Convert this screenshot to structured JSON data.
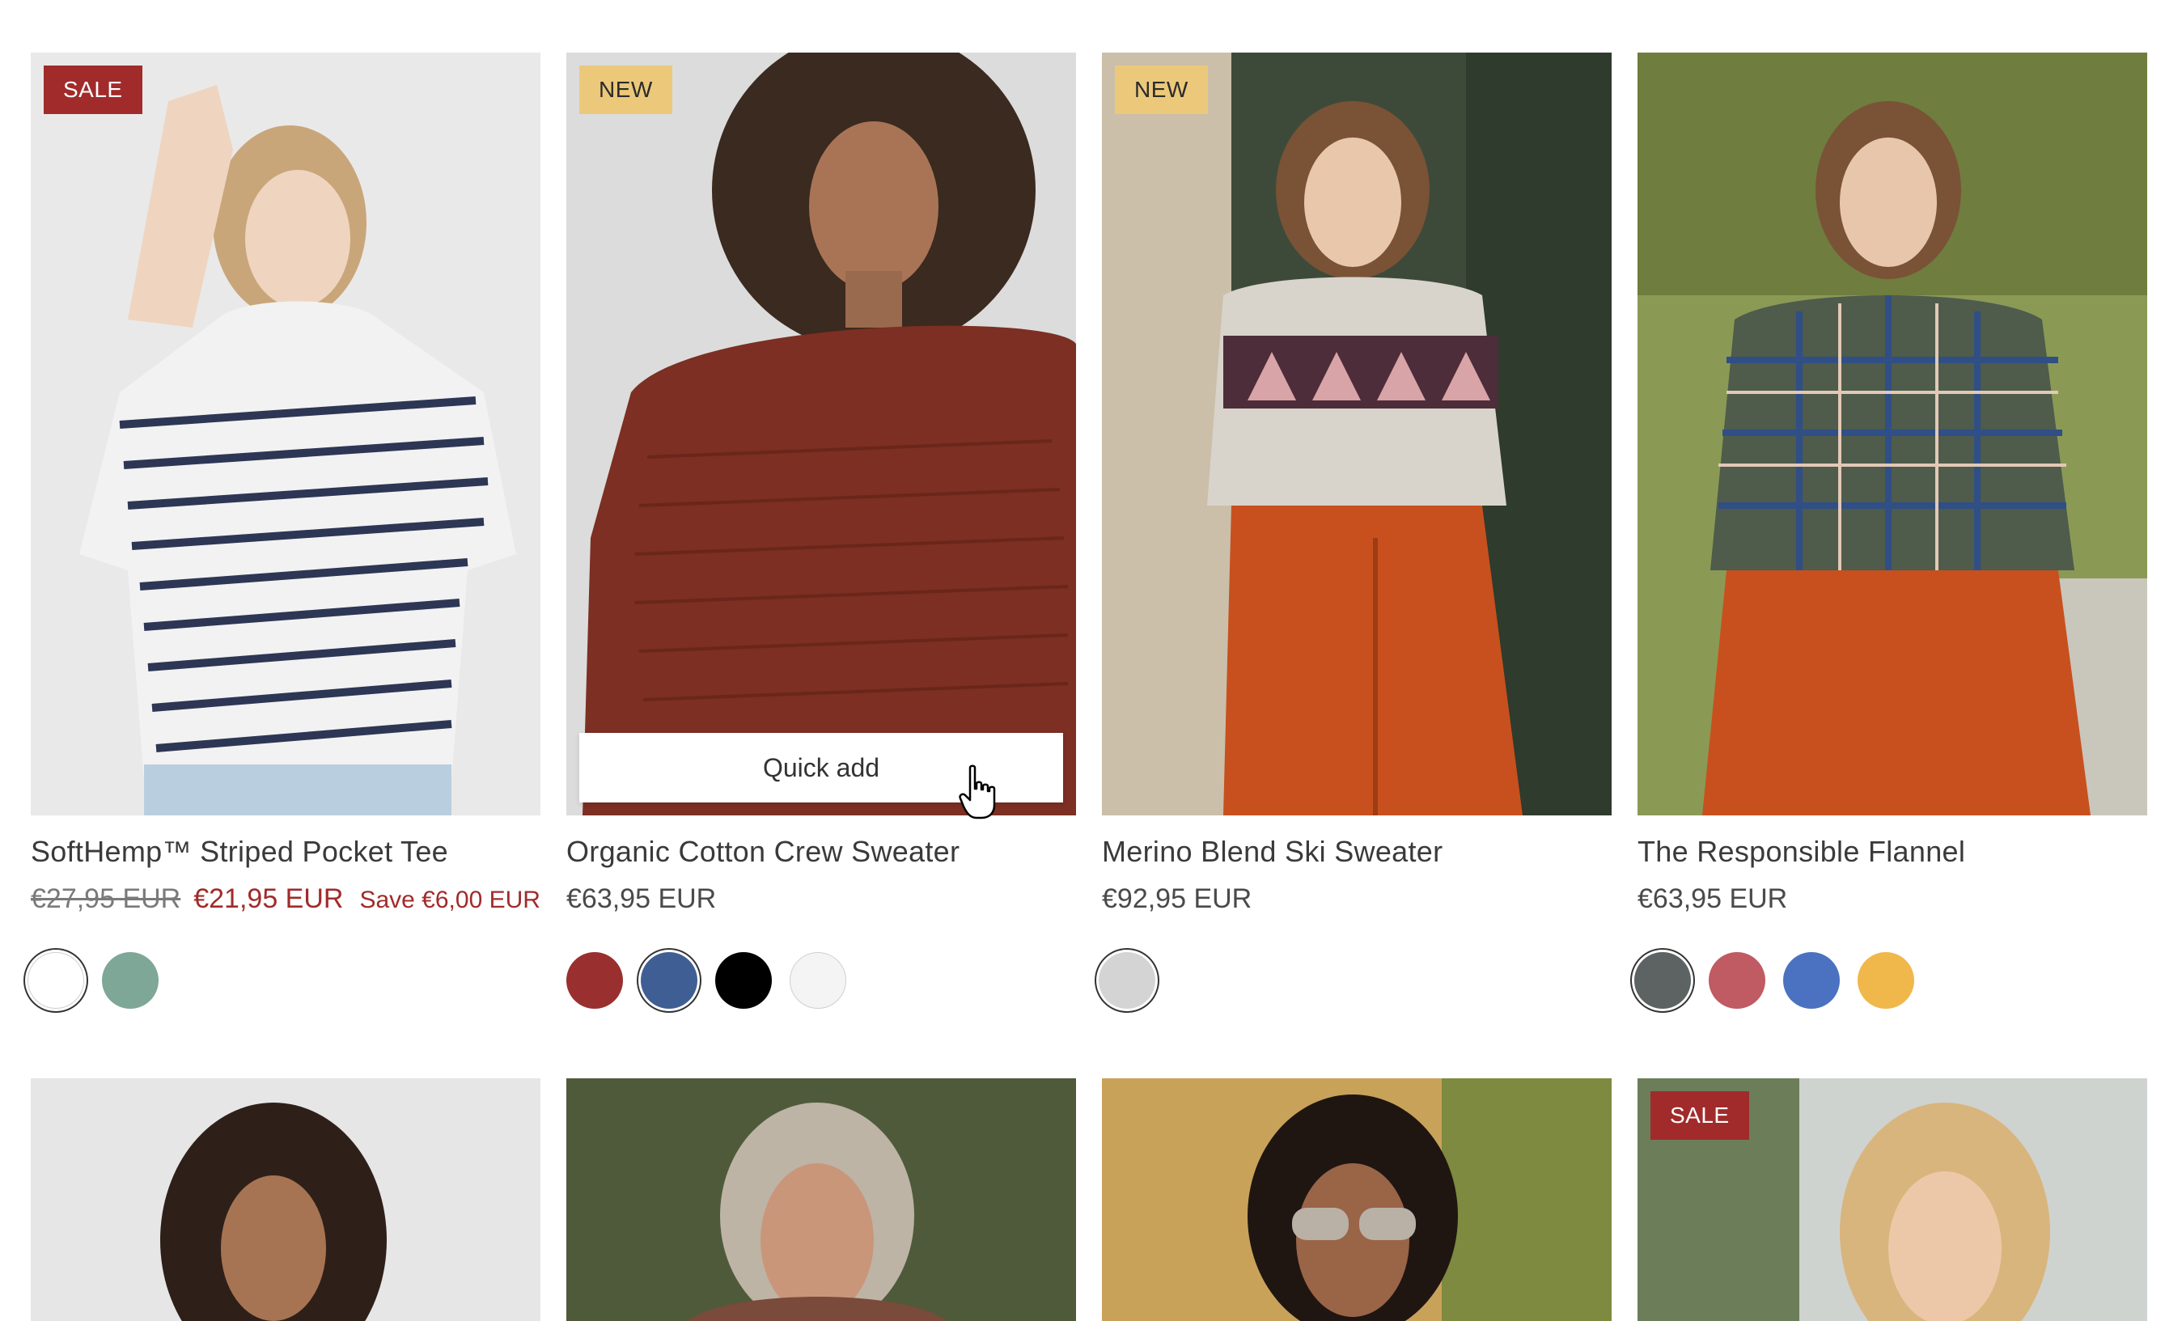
{
  "products": [
    {
      "badge": "SALE",
      "title": "SoftHemp™ Striped Pocket Tee",
      "price_original": "€27,95 EUR",
      "price_sale": "€21,95 EUR",
      "price_save": "Save €6,00 EUR",
      "swatches": [
        "#ffffff",
        "#7ea797"
      ]
    },
    {
      "badge": "NEW",
      "title": "Organic Cotton Crew Sweater",
      "price": "€63,95 EUR",
      "quick_add": "Quick add",
      "swatches": [
        "#9a2f2f",
        "#3f5f94",
        "#000000",
        "#f4f4f4"
      ]
    },
    {
      "badge": "NEW",
      "title": "Merino Blend Ski Sweater",
      "price": "€92,95 EUR",
      "swatches": [
        "#d4d4d4"
      ]
    },
    {
      "title": "The Responsible Flannel",
      "price": "€63,95 EUR",
      "swatches": [
        "#5d6363",
        "#c05a63",
        "#4b72c0",
        "#f0b74a"
      ]
    },
    {},
    {},
    {},
    {
      "badge": "SALE"
    }
  ],
  "colors": {
    "sale_badge": "#a12b2b",
    "new_badge": "#ecc97a",
    "sale_price": "#a12b2b"
  }
}
